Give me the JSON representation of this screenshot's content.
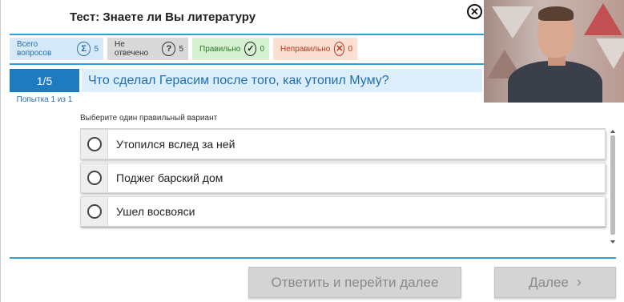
{
  "header": {
    "title": "Тест: Знаете ли Вы литературу",
    "close_symbol": "✕"
  },
  "stats": {
    "total": {
      "label": "Всего вопросов",
      "icon": "sigma-icon",
      "symbol": "Σ",
      "count": "5",
      "color": "#2b6ea8",
      "bg": "#d6e9f8"
    },
    "unanswered": {
      "label": "Не отвечено",
      "icon": "question-icon",
      "symbol": "?",
      "count": "5",
      "color": "#333333",
      "bg": "#d9d9d9"
    },
    "correct": {
      "label": "Правильно",
      "icon": "check-icon",
      "symbol": "✓",
      "count": "0",
      "color": "#2a7a2a",
      "bg": "#d6f2d2"
    },
    "wrong": {
      "label": "Неправильно",
      "icon": "cross-icon",
      "symbol": "✕",
      "count": "0",
      "color": "#b5381f",
      "bg": "#fbe0d2"
    }
  },
  "question": {
    "number": "1/5",
    "text": "Что сделал Герасим после того, как утопил Муму?",
    "attempt": "Попытка 1 из 1",
    "instruction": "Выберите один правильный вариант",
    "options": [
      {
        "label": "Утопился вслед за ней",
        "selected": false
      },
      {
        "label": "Поджег барский дом",
        "selected": false
      },
      {
        "label": "Ушел восвояси",
        "selected": false
      }
    ]
  },
  "footer": {
    "answer_next_label": "Ответить и перейти далее",
    "next_label": "Далее",
    "next_chevron": "›"
  },
  "colors": {
    "accent": "#2f9fd8",
    "question_number_bg": "#1f7bbf",
    "question_bar_bg": "#ddeefb",
    "disabled_button_bg": "#d4d4d4"
  }
}
